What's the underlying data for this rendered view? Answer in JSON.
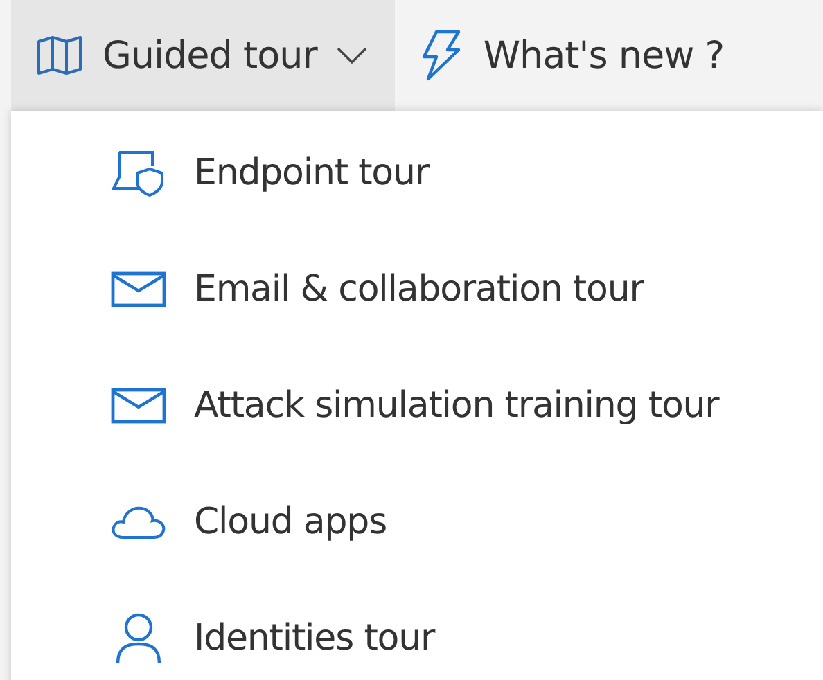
{
  "toolbar": {
    "buttons": [
      {
        "kind": "map",
        "label": "Guided tour",
        "expanded": true
      },
      {
        "kind": "bolt",
        "label": "What's new ?",
        "expanded": false
      }
    ]
  },
  "menu": {
    "items": [
      {
        "kind": "endpoint",
        "label": "Endpoint tour"
      },
      {
        "kind": "mail",
        "label": "Email & collaboration tour"
      },
      {
        "kind": "mail",
        "label": "Attack simulation training tour"
      },
      {
        "kind": "cloud",
        "label": "Cloud apps"
      },
      {
        "kind": "person",
        "label": "Identities tour"
      }
    ]
  }
}
